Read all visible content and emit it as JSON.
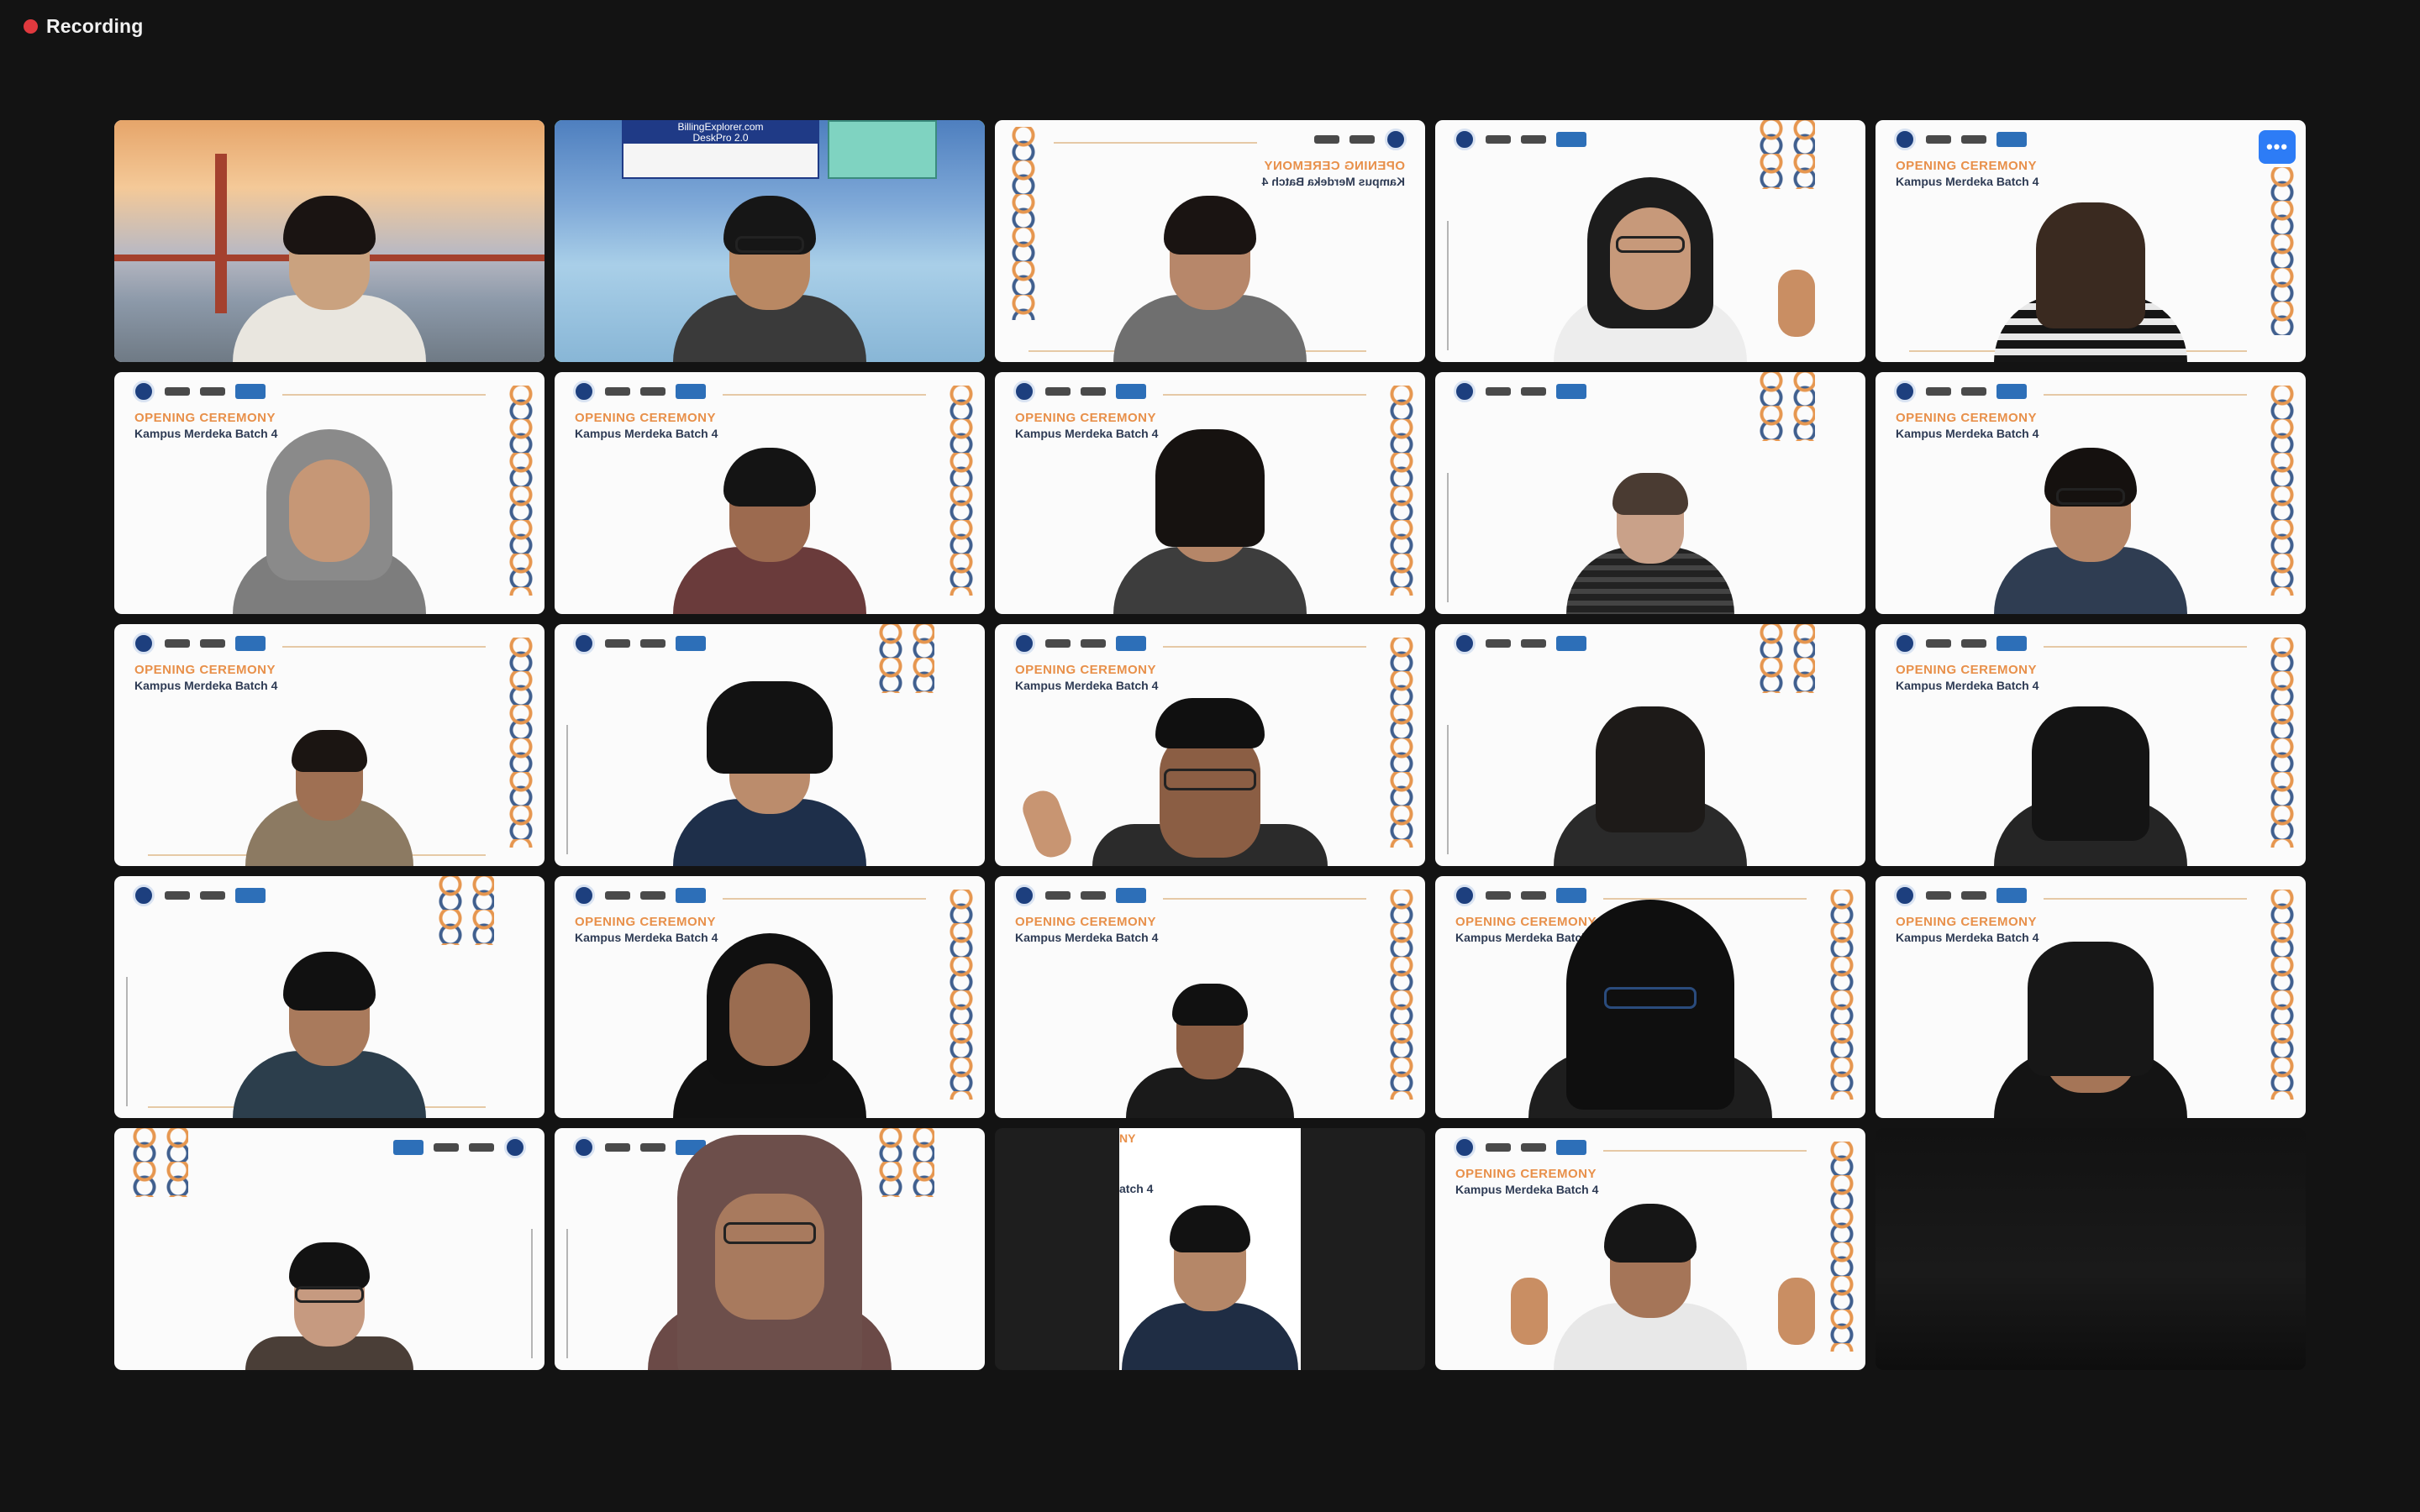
{
  "recording": {
    "label": "Recording",
    "indicator_color": "#e0393e"
  },
  "more_options_icon": "more-horizontal-icon",
  "more_options_label": "•••",
  "banner": {
    "title": "OPENING CEREMONY",
    "subtitle": "Kampus Merdeka Batch 4"
  },
  "tile_23": {
    "banner_title_partial": "NY",
    "banner_subtitle_partial": "atch 4"
  },
  "tile_2": {
    "overlay_line1": "BillingExplorer.com",
    "overlay_line2": "DeskPro 2.0"
  },
  "colors": {
    "active_speaker_border": "#5fd35b",
    "accent_orange": "#e8904a",
    "accent_navy": "#2e3b54",
    "more_button": "#2d7cf6"
  }
}
